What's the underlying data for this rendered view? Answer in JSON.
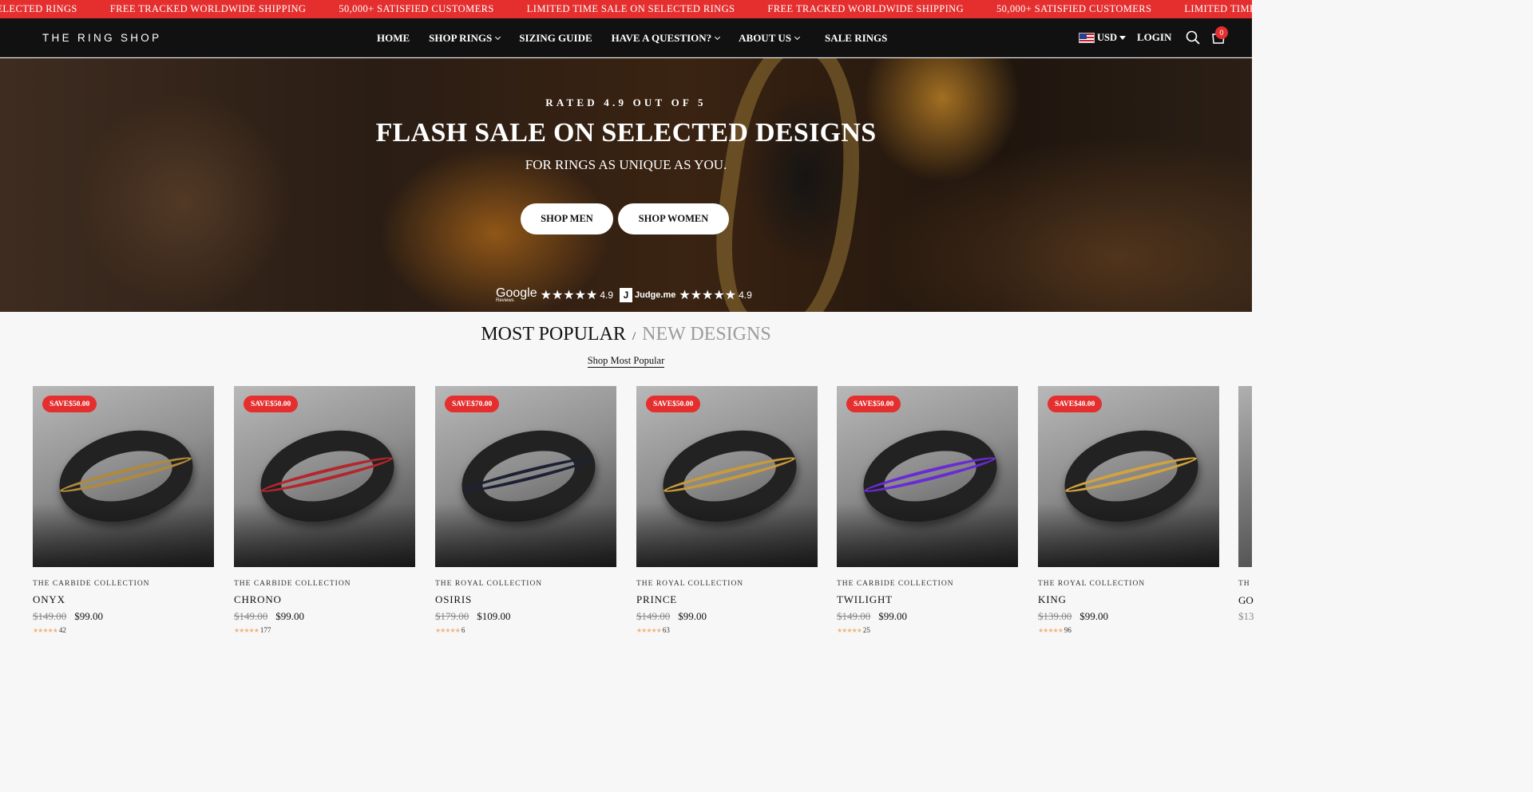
{
  "announcement": {
    "items": [
      "SELECTED RINGS",
      "FREE TRACKED WORLDWIDE SHIPPING",
      "50,000+ SATISFIED CUSTOMERS",
      "LIMITED TIME SALE ON SELECTED RINGS",
      "FREE TRACKED WORLDWIDE SHIPPING",
      "50,000+ SATISFIED CUSTOMERS",
      "LIMITED TIME SALE ON SELEC"
    ],
    "color": "#e52f2f"
  },
  "header": {
    "logo": "THE RING SHOP",
    "nav": [
      {
        "label": "HOME",
        "has_dropdown": false
      },
      {
        "label": "SHOP RINGS",
        "has_dropdown": true
      },
      {
        "label": "SIZING GUIDE",
        "has_dropdown": false
      },
      {
        "label": "HAVE A QUESTION?",
        "has_dropdown": true
      },
      {
        "label": "ABOUT US",
        "has_dropdown": true
      },
      {
        "label": "SALE RINGS",
        "has_dropdown": false
      }
    ],
    "currency": "USD",
    "login": "LOGIN",
    "cart_count": "0"
  },
  "hero": {
    "eyebrow": "RATED 4.9 OUT OF 5",
    "title": "FLASH SALE ON SELECTED DESIGNS",
    "subtitle": "FOR RINGS AS UNIQUE AS YOU.",
    "buttons": {
      "men": "SHOP MEN",
      "women": "SHOP WOMEN"
    },
    "reviews": {
      "google_label": "Google",
      "google_sub": "Reviews",
      "google_rating": "4.9",
      "judge_label": "Judge.me",
      "judge_letter": "J",
      "judge_rating": "4.9",
      "stars": "★★★★★"
    }
  },
  "section": {
    "active_tab": "MOST POPULAR",
    "separator": "/",
    "inactive_tab": "NEW DESIGNS",
    "link": "Shop Most Popular"
  },
  "products": [
    {
      "badge": "SAVE$50.00",
      "collection": "THE CARBIDE COLLECTION",
      "name": "ONYX",
      "old_price": "$149.00",
      "price": "$99.00",
      "reviews": "42",
      "inlay": "#b08a3a"
    },
    {
      "badge": "SAVE$50.00",
      "collection": "THE CARBIDE COLLECTION",
      "name": "CHRONO",
      "old_price": "$149.00",
      "price": "$99.00",
      "reviews": "177",
      "inlay": "#b3262b"
    },
    {
      "badge": "SAVE$70.00",
      "collection": "THE ROYAL COLLECTION",
      "name": "OSIRIS",
      "old_price": "$179.00",
      "price": "$109.00",
      "reviews": "6",
      "inlay": "#1d2033"
    },
    {
      "badge": "SAVE$50.00",
      "collection": "THE ROYAL COLLECTION",
      "name": "PRINCE",
      "old_price": "$149.00",
      "price": "$99.00",
      "reviews": "63",
      "inlay": "#c79a3c"
    },
    {
      "badge": "SAVE$50.00",
      "collection": "THE CARBIDE COLLECTION",
      "name": "TWILIGHT",
      "old_price": "$149.00",
      "price": "$99.00",
      "reviews": "25",
      "inlay": "#6a2bd3"
    },
    {
      "badge": "SAVE$40.00",
      "collection": "THE ROYAL COLLECTION",
      "name": "KING",
      "old_price": "$139.00",
      "price": "$99.00",
      "reviews": "96",
      "inlay": "#d1a23f"
    }
  ],
  "partial_product": {
    "collection": "TH",
    "name": "GO",
    "old_price": "$13"
  },
  "review_stars": "★★★★★"
}
